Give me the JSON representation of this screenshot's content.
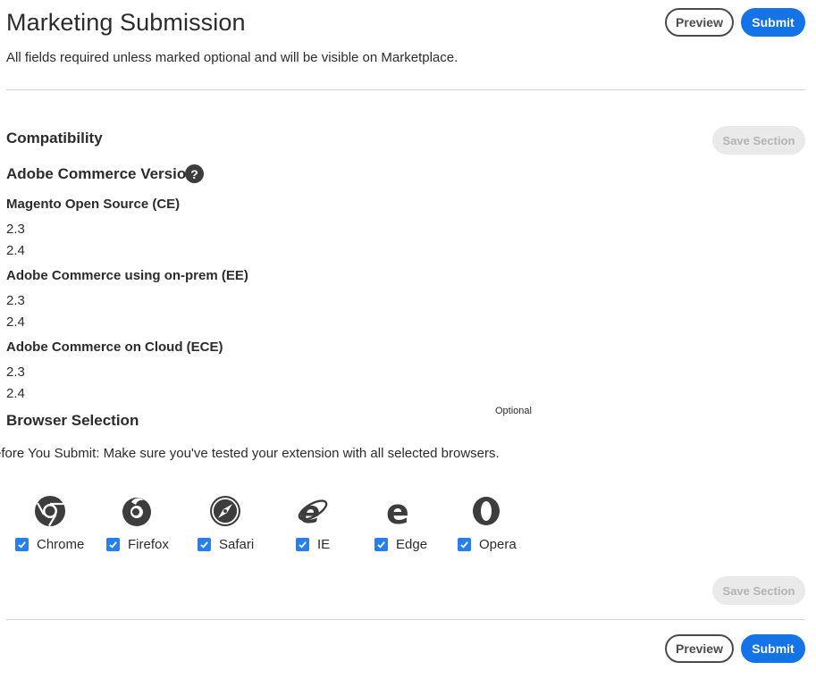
{
  "header": {
    "title": "Marketing Submission",
    "subtitle": "All fields required unless marked optional and will be visible on Marketplace.",
    "preview_label": "Preview",
    "submit_label": "Submit"
  },
  "compatibility": {
    "title": "Compatibility",
    "save_label": "Save Section",
    "version_title": "Adobe Commerce Version",
    "help_icon": "question-circle-icon",
    "groups": [
      {
        "name": "Magento Open Source (CE)",
        "versions": [
          "2.3",
          "2.4"
        ]
      },
      {
        "name": "Adobe Commerce using on-prem (EE)",
        "versions": [
          "2.3",
          "2.4"
        ]
      },
      {
        "name": "Adobe Commerce on Cloud (ECE)",
        "versions": [
          "2.3",
          "2.4"
        ]
      }
    ]
  },
  "browsers": {
    "title": "Browser Selection",
    "optional_label": "Optional",
    "note": "efore You Submit: Make sure you've tested your extension with all selected browsers.",
    "items": [
      {
        "label": "Chrome",
        "icon": "chrome-icon",
        "checked": true
      },
      {
        "label": "Firefox",
        "icon": "firefox-icon",
        "checked": true
      },
      {
        "label": "Safari",
        "icon": "safari-icon",
        "checked": true
      },
      {
        "label": "IE",
        "icon": "ie-icon",
        "checked": true
      },
      {
        "label": "Edge",
        "icon": "edge-icon",
        "checked": true
      },
      {
        "label": "Opera",
        "icon": "opera-icon",
        "checked": true
      }
    ],
    "save_label": "Save Section"
  },
  "footer": {
    "preview_label": "Preview",
    "submit_label": "Submit"
  },
  "colors": {
    "accent": "#1473e6",
    "checkbox": "#2680eb",
    "text": "#2c2c2c",
    "disabled_bg": "#eaeaea"
  }
}
